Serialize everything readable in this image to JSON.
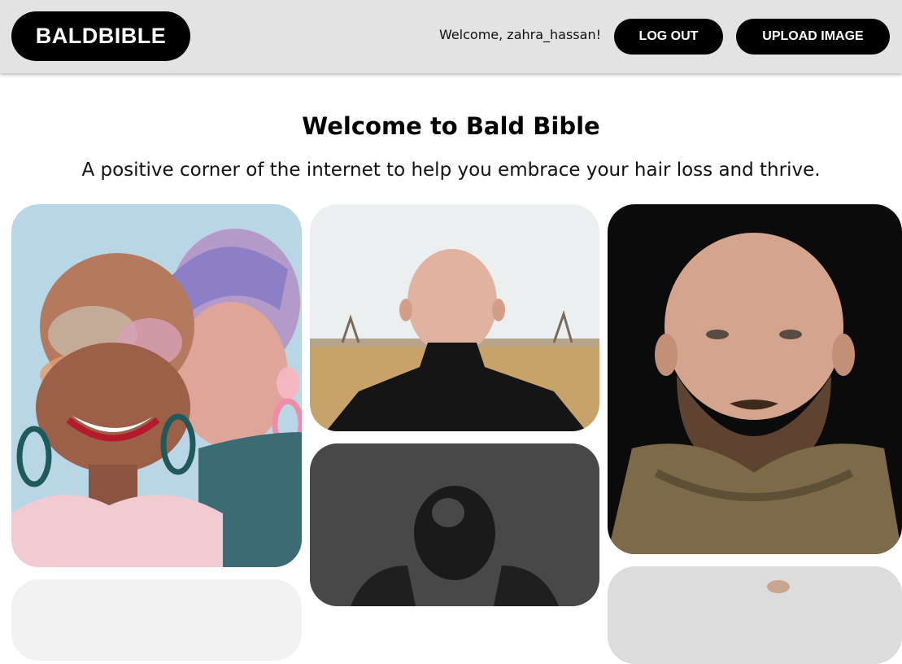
{
  "navbar": {
    "logo": "BALDBIBLE",
    "welcome_text": "Welcome, zahra_hassan!",
    "logout_label": "LOG OUT",
    "upload_label": "UPLOAD IMAGE"
  },
  "main": {
    "heading": "Welcome to Bald Bible",
    "tagline": "A positive corner of the internet to help you embrace your hair loss and thrive."
  },
  "gallery": {
    "images": [
      {
        "name": "two-women-painted-faces-photo"
      },
      {
        "name": "man-back-of-head-field-photo"
      },
      {
        "name": "bearded-bald-man-portrait-photo"
      },
      {
        "name": "bald-man-hands-on-head-bw-photo"
      },
      {
        "name": "partial-image-bottom-left"
      },
      {
        "name": "partial-image-bottom-right"
      }
    ]
  }
}
